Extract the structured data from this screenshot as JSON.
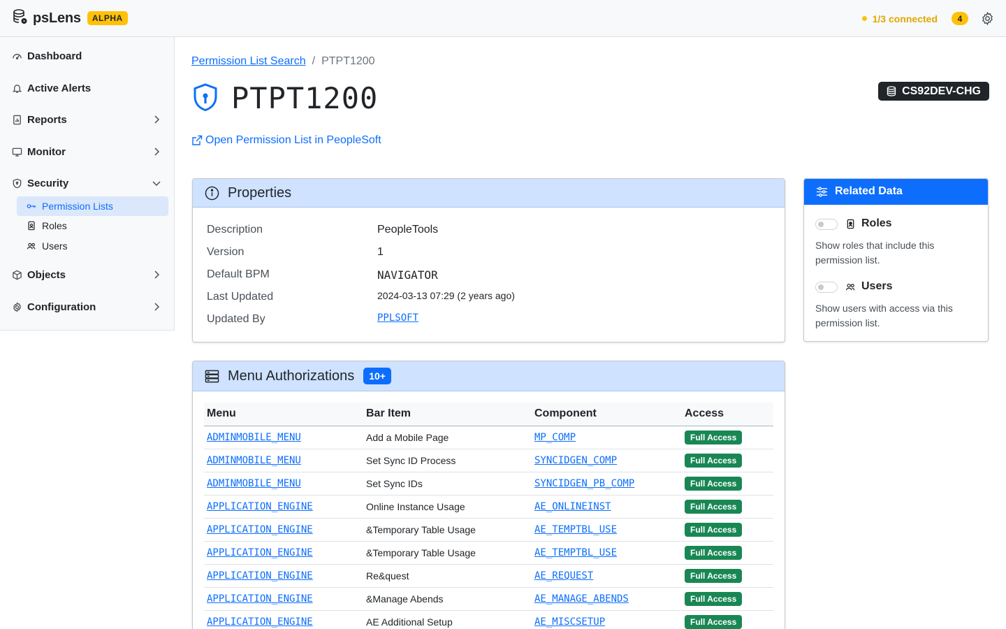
{
  "header": {
    "app_name": "psLens",
    "badge": "ALPHA",
    "connection_status": "1/3 connected",
    "notification_count": "4"
  },
  "sidebar": {
    "items": [
      {
        "label": "Dashboard",
        "icon": "gauge-icon"
      },
      {
        "label": "Active Alerts",
        "icon": "bell-icon"
      },
      {
        "label": "Reports",
        "icon": "report-icon"
      },
      {
        "label": "Monitor",
        "icon": "monitor-icon"
      },
      {
        "label": "Security",
        "icon": "shield-icon"
      },
      {
        "label": "Objects",
        "icon": "box-icon"
      },
      {
        "label": "Configuration",
        "icon": "gear-icon"
      }
    ],
    "security_sub": [
      {
        "label": "Permission Lists",
        "icon": "key-icon"
      },
      {
        "label": "Roles",
        "icon": "badge-icon"
      },
      {
        "label": "Users",
        "icon": "users-icon"
      }
    ]
  },
  "breadcrumb": {
    "parent": "Permission List Search",
    "separator": "/",
    "current": "PTPT1200"
  },
  "page": {
    "title": "PTPT1200",
    "environment": "CS92DEV-CHG",
    "open_link": "Open Permission List in PeopleSoft"
  },
  "properties": {
    "title": "Properties",
    "rows": [
      {
        "label": "Description",
        "value": "PeopleTools"
      },
      {
        "label": "Version",
        "value": "1"
      },
      {
        "label": "Default BPM",
        "value": "NAVIGATOR"
      },
      {
        "label": "Last Updated",
        "value": "2024-03-13 07:29 (2 years ago)"
      },
      {
        "label": "Updated By",
        "value": "PPLSOFT"
      }
    ]
  },
  "related": {
    "title": "Related Data",
    "roles_title": "Roles",
    "roles_desc": "Show roles that include this permission list.",
    "users_title": "Users",
    "users_desc": "Show users with access via this permission list."
  },
  "menu_auth": {
    "title": "Menu Authorizations",
    "count": "10+",
    "columns": [
      "Menu",
      "Bar Item",
      "Component",
      "Access"
    ],
    "rows": [
      [
        "ADMINMOBILE_MENU",
        "Add a Mobile Page",
        "MP_COMP",
        "Full Access"
      ],
      [
        "ADMINMOBILE_MENU",
        "Set Sync ID Process",
        "SYNCIDGEN_COMP",
        "Full Access"
      ],
      [
        "ADMINMOBILE_MENU",
        "Set Sync IDs",
        "SYNCIDGEN_PB_COMP",
        "Full Access"
      ],
      [
        "APPLICATION_ENGINE",
        "Online Instance Usage",
        "AE_ONLINEINST",
        "Full Access"
      ],
      [
        "APPLICATION_ENGINE",
        "&Temporary Table Usage",
        "AE_TEMPTBL_USE",
        "Full Access"
      ],
      [
        "APPLICATION_ENGINE",
        "&Temporary Table Usage",
        "AE_TEMPTBL_USE",
        "Full Access"
      ],
      [
        "APPLICATION_ENGINE",
        "Re&quest",
        "AE_REQUEST",
        "Full Access"
      ],
      [
        "APPLICATION_ENGINE",
        "&Manage Abends",
        "AE_MANAGE_ABENDS",
        "Full Access"
      ],
      [
        "APPLICATION_ENGINE",
        "AE Additional Setup",
        "AE_MISCSETUP",
        "Full Access"
      ]
    ]
  },
  "colors": {
    "primary": "#0d6efd",
    "warning": "#ffc107",
    "success": "#198754",
    "card_header": "#cfe2ff"
  }
}
